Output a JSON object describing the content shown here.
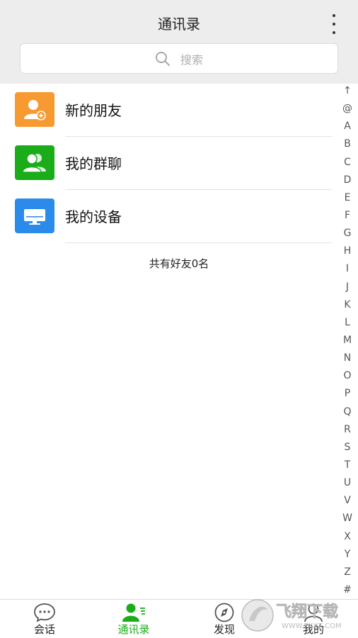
{
  "header": {
    "title": "通讯录"
  },
  "search": {
    "placeholder": "搜索"
  },
  "list": [
    {
      "label": "新的朋友",
      "color": "#f79a32",
      "icon": "add-friend-icon"
    },
    {
      "label": "我的群聊",
      "color": "#1aad19",
      "icon": "group-icon"
    },
    {
      "label": "我的设备",
      "color": "#2a8bea",
      "icon": "monitor-icon"
    }
  ],
  "friend_count": "共有好友0名",
  "index": [
    "↑",
    "@",
    "A",
    "B",
    "C",
    "D",
    "E",
    "F",
    "G",
    "H",
    "I",
    "J",
    "K",
    "L",
    "M",
    "N",
    "O",
    "P",
    "Q",
    "R",
    "S",
    "T",
    "U",
    "V",
    "W",
    "X",
    "Y",
    "Z",
    "#"
  ],
  "tabs": [
    {
      "label": "会话",
      "icon": "chat-bubble-icon",
      "active": false
    },
    {
      "label": "通讯录",
      "icon": "contacts-icon",
      "active": true
    },
    {
      "label": "发现",
      "icon": "compass-icon",
      "active": false
    },
    {
      "label": "我的",
      "icon": "person-icon",
      "active": false
    }
  ],
  "watermark": {
    "text": "飞翔下载",
    "url": "WWW.FXXZ.COM"
  },
  "colors": {
    "accent": "#1aad19",
    "header_bg": "#ededed"
  }
}
